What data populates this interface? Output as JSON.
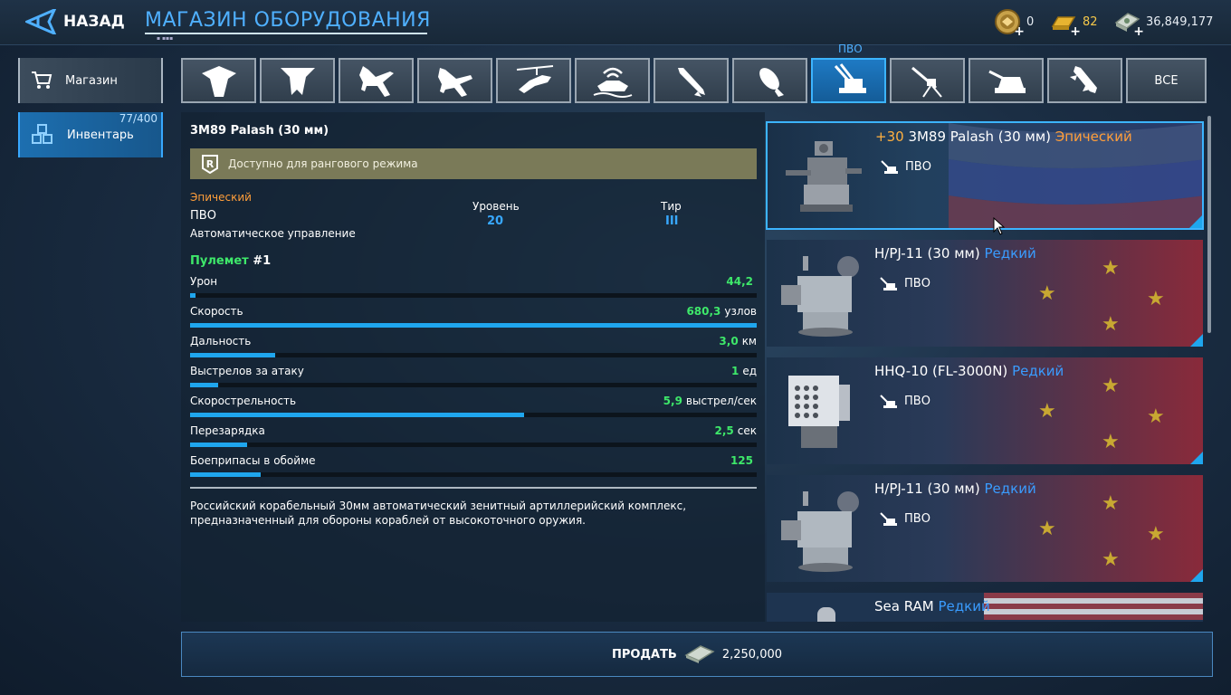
{
  "header": {
    "back_label": "НАЗАД",
    "title": "МАГАЗИН ОБОРУДОВАНИЯ",
    "currencies": [
      {
        "icon": "medal-icon",
        "value": "0"
      },
      {
        "icon": "gold-bar-icon",
        "value": "82",
        "color": "#f5c84a"
      },
      {
        "icon": "cash-icon",
        "value": "36,849,177"
      }
    ]
  },
  "sidebar": {
    "shop_label": "Магазин",
    "inventory_label": "Инвентарь",
    "inventory_count": "77/400"
  },
  "tabs": {
    "active_label": "ПВО",
    "all_label": "ВСЕ",
    "items": [
      "stealth-bomber-icon",
      "flying-wing-icon",
      "fighter-jet-icon",
      "fighter-jet-2-icon",
      "helicopter-icon",
      "ship-radar-icon",
      "missile-icon",
      "bomb-icon",
      "air-defense-icon",
      "machine-gun-icon",
      "naval-turret-icon",
      "rocket-icon"
    ],
    "active_index": 8
  },
  "detail": {
    "name": "3М89 Palash (30 мм)",
    "ranked_note": "Доступно для рангового режима",
    "rarity": "Эпический",
    "category": "ПВО",
    "control": "Автоматическое управление",
    "level_label": "Уровень",
    "level_value": "20",
    "tier_label": "Тир",
    "tier_value": "III",
    "weapon_name": "Пулемет",
    "weapon_num": "#1",
    "stats": [
      {
        "label": "Урон",
        "value": "44,2",
        "unit": "",
        "fill": 0.01
      },
      {
        "label": "Скорость",
        "value": "680,3",
        "unit": "узлов",
        "fill": 1.0
      },
      {
        "label": "Дальность",
        "value": "3,0",
        "unit": "км",
        "fill": 0.15
      },
      {
        "label": "Выстрелов за атаку",
        "value": "1",
        "unit": "ед",
        "fill": 0.05
      },
      {
        "label": "Скорострельность",
        "value": "5,9",
        "unit": "выстрел/сек",
        "fill": 0.59
      },
      {
        "label": "Перезарядка",
        "value": "2,5",
        "unit": "сек",
        "fill": 0.1
      },
      {
        "label": "Боеприпасы в обойме",
        "value": "125",
        "unit": "",
        "fill": 0.125
      }
    ],
    "description": "Российский корабельный 30мм автоматический зенитный артиллерийский комплекс, предназначенный для обороны кораблей от высокоточного оружия."
  },
  "items": [
    {
      "bonus": "+30",
      "name": "3М89 Palash (30 мм)",
      "rarity": "Эпический",
      "rarity_class": "epic",
      "category": "ПВО",
      "flag": "russia",
      "selected": true
    },
    {
      "bonus": "",
      "name": "H/PJ-11 (30 мм)",
      "rarity": "Редкий",
      "rarity_class": "rare",
      "category": "ПВО",
      "flag": "china",
      "selected": false
    },
    {
      "bonus": "",
      "name": "HHQ-10 (FL-3000N)",
      "rarity": "Редкий",
      "rarity_class": "rare",
      "category": "ПВО",
      "flag": "china",
      "selected": false
    },
    {
      "bonus": "",
      "name": "H/PJ-11 (30 мм)",
      "rarity": "Редкий",
      "rarity_class": "rare",
      "category": "ПВО",
      "flag": "china",
      "selected": false
    },
    {
      "bonus": "",
      "name": "Sea RAM",
      "rarity": "Редкий",
      "rarity_class": "rare",
      "category": "",
      "flag": "usa",
      "selected": false
    }
  ],
  "sell": {
    "label": "ПРОДАТЬ",
    "price": "2,250,000"
  }
}
